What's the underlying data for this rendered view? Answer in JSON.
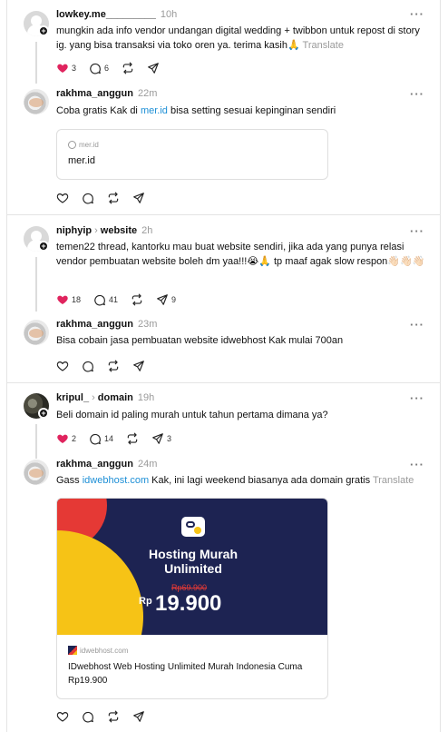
{
  "threads": [
    {
      "author": "lowkey.me_________",
      "time": "10h",
      "text": "mungkin ada info vendor undangan digital wedding + twibbon untuk repost di story ig. yang bisa transaksi via toko oren ya. terima kasih🙏",
      "translate": "Translate",
      "likes": "3",
      "replies": "6",
      "reply": {
        "author": "rakhma_anggun",
        "time": "22m",
        "text_before": "Coba gratis Kak di ",
        "link": "mer.id",
        "text_after": " bisa setting sesuai kepinginan sendiri",
        "card_domain": "mer.id",
        "card_title": "mer.id"
      }
    },
    {
      "author": "niphyip",
      "topic": "website",
      "time": "2h",
      "text": "temen22 thread, kantorku mau buat website sendiri, jika ada yang punya relasi vendor pembuatan website boleh dm yaa!!!😭🙏 tp maaf agak slow respon👋🏻👋🏻👋🏻",
      "likes": "18",
      "replies": "41",
      "shares": "9",
      "reply": {
        "author": "rakhma_anggun",
        "time": "23m",
        "text": "Bisa cobain jasa pembuatan website idwebhost Kak mulai 700an"
      }
    },
    {
      "author": "kripul_",
      "topic": "domain",
      "time": "19h",
      "text": "Beli domain id paling murah untuk tahun pertama dimana ya?",
      "likes": "2",
      "replies": "14",
      "shares": "3",
      "reply": {
        "author": "rakhma_anggun",
        "time": "24m",
        "text_before": "Gass ",
        "link": "idwebhost.com",
        "text_after": " Kak, ini lagi weekend biasanya ada domain gratis",
        "translate": "Translate",
        "banner_title": "Hosting Murah Unlimited",
        "banner_old_price": "Rp69.900",
        "banner_currency": "Rp",
        "banner_price": "19.900",
        "card_domain": "idwebhost.com",
        "card_title": "IDwebhost Web Hosting Unlimited Murah Indonesia Cuma Rp19.900"
      }
    }
  ],
  "icons": [
    "heart-icon",
    "comment-icon",
    "repost-icon",
    "share-icon",
    "more-icon",
    "globe-icon",
    "chevron-right-icon",
    "follow-plus-icon"
  ],
  "colors": {
    "link": "#1d8fd6",
    "like": "#e0245e",
    "muted": "#9a9a9a",
    "banner_bg": "#1d2352",
    "banner_red": "#e53935",
    "banner_yellow": "#f6c316"
  }
}
